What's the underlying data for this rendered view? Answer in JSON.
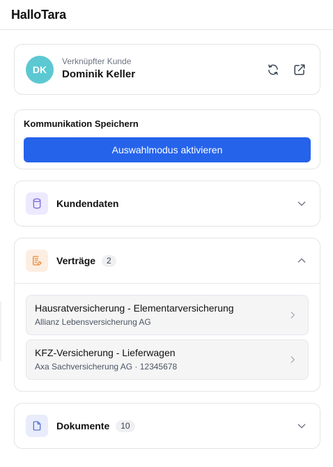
{
  "app": {
    "title": "HalloTara"
  },
  "customer": {
    "caption": "Verknüpfter Kunde",
    "name": "Dominik Keller",
    "initials": "DK",
    "avatar_color": "#5cc8d1",
    "actions": [
      {
        "icon": "refresh-icon"
      },
      {
        "icon": "external-link-icon"
      }
    ]
  },
  "communication": {
    "title": "Kommunikation Speichern",
    "button_label": "Auswahlmodus aktivieren",
    "button_color": "#2563eb"
  },
  "sections": {
    "kundendaten": {
      "title": "Kundendaten",
      "icon": "database-icon",
      "expanded": false
    },
    "vertraege": {
      "title": "Verträge",
      "count": "2",
      "icon": "contract-document-icon",
      "expanded": true,
      "items": [
        {
          "title": "Hausratversicherung - Elementarversicherung",
          "subtitle": "Allianz Lebensversicherung AG"
        },
        {
          "title": "KFZ-Versicherung - Lieferwagen",
          "subtitle": "Axa Sachversicherung AG · 12345678"
        }
      ]
    },
    "dokumente": {
      "title": "Dokumente",
      "count": "10",
      "icon": "file-icon",
      "expanded": false
    }
  }
}
